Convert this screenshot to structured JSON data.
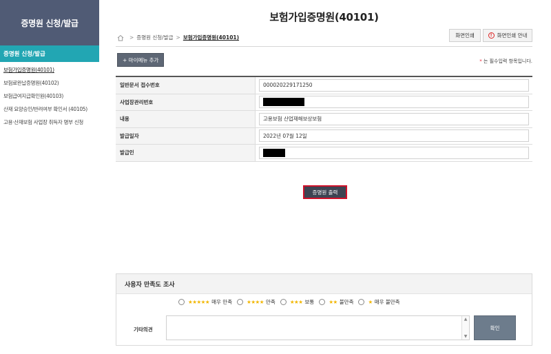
{
  "sidebar": {
    "title": "증명원 신청/발급",
    "section": "증명원 신청/발급",
    "items": [
      {
        "label": "보험가입증명원(40101)"
      },
      {
        "label": "보험료완납증명원(40102)"
      },
      {
        "label": "보험급여지급확인원(40103)"
      },
      {
        "label": "산재 요양승인/반려여부 확인서 (40105)"
      },
      {
        "label": "고용·산재보험 사업장 취득자 명부 신청"
      }
    ]
  },
  "header": {
    "title": "보험가입증명원(40101)",
    "breadcrumb": [
      "증명원 신청/발급",
      "보험가입증명원(40101)"
    ],
    "print_label": "화면인쇄",
    "print_guide_label": "화면인쇄 안내"
  },
  "toolbar": {
    "add_menu_label": "+ 마이메뉴 추가",
    "required_note_star": "*",
    "required_note": "는 필수입력 항목입니다."
  },
  "form": {
    "rows": [
      {
        "label": "일반문서 접수번호",
        "value": "000020229171250",
        "redacted": false
      },
      {
        "label": "사업장관리번호",
        "value": "",
        "redacted": true
      },
      {
        "label": "내용",
        "value": "고용보험 산업재해보상보험",
        "redacted": false
      },
      {
        "label": "발급일자",
        "value": "2022년 07월 12일",
        "redacted": false
      },
      {
        "label": "발급인",
        "value": "",
        "redacted": true
      }
    ]
  },
  "actions": {
    "output_label": "증명원 출력"
  },
  "survey": {
    "title": "사용자 만족도 조사",
    "options": [
      {
        "stars": "★★★★★",
        "label": "매우 만족"
      },
      {
        "stars": "★★★★",
        "label": "만족"
      },
      {
        "stars": "★★★",
        "label": "보통"
      },
      {
        "stars": "★★",
        "label": "불만족"
      },
      {
        "stars": "★",
        "label": "매우 불만족"
      }
    ],
    "etc_label": "기타의견",
    "etc_value": "",
    "confirm_label": "확인"
  },
  "colors": {
    "sidebar_header": "#505b75",
    "sidebar_section": "#22a6b3",
    "output_button_border": "#d0112a",
    "star": "#f2b705"
  }
}
